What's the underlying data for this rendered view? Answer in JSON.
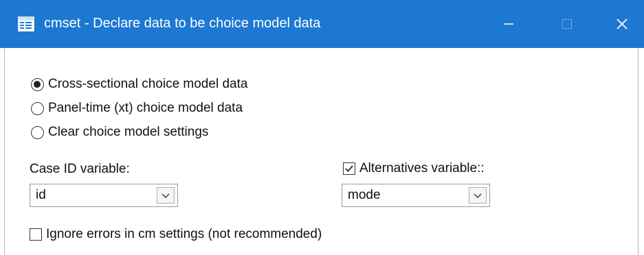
{
  "window": {
    "title": "cmset - Declare data to be choice model data",
    "accent_color": "#1c78d2",
    "icons": {
      "app": "dialog-icon",
      "minimize": "minimize-icon",
      "maximize": "maximize-icon",
      "close": "close-icon"
    }
  },
  "data_type": {
    "options": [
      {
        "label": "Cross-sectional choice model data",
        "selected": true
      },
      {
        "label": "Panel-time (xt) choice model data",
        "selected": false
      },
      {
        "label": "Clear choice model settings",
        "selected": false
      }
    ]
  },
  "case_id": {
    "label": "Case ID variable:",
    "value": "id"
  },
  "alternatives": {
    "label": "Alternatives variable::",
    "checked": true,
    "value": "mode"
  },
  "ignore_errors": {
    "label": "Ignore errors in cm settings (not recommended)",
    "checked": false
  }
}
